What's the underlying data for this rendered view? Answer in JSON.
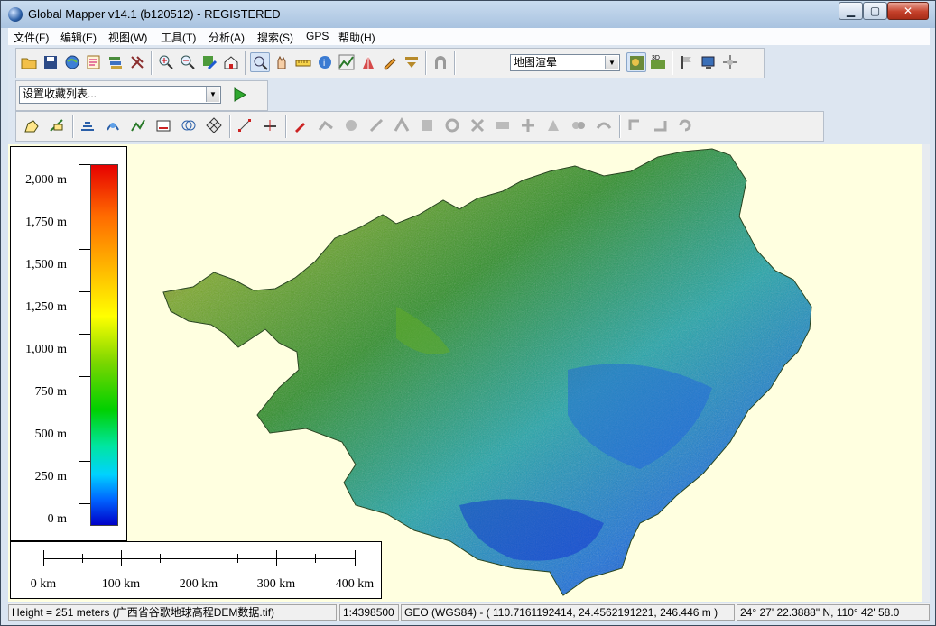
{
  "window": {
    "title": "Global Mapper v14.1 (b120512) - REGISTERED",
    "min_glyph": "▁",
    "max_glyph": "▢",
    "close_glyph": "✕"
  },
  "menu": [
    {
      "label": "文件(F)"
    },
    {
      "label": "编辑(E)"
    },
    {
      "label": "视图(W)"
    },
    {
      "label": "工具(T)"
    },
    {
      "label": "分析(A)"
    },
    {
      "label": "搜索(S)"
    },
    {
      "label": "GPS"
    },
    {
      "label": "帮助(H)"
    }
  ],
  "toolbar": {
    "render_mode": "地图渲晕",
    "favorites": "设置收藏列表..."
  },
  "legend": {
    "labels": [
      "2,000 m",
      "1,750 m",
      "1,500 m",
      "1,250 m",
      "1,000 m",
      "750 m",
      "500 m",
      "250 m",
      "0 m"
    ],
    "color_high": "#e60000",
    "color_low": "#0000c8"
  },
  "scalebar": {
    "labels": [
      "0 km",
      "100 km",
      "200 km",
      "300 km",
      "400 km"
    ]
  },
  "status": {
    "height": "Height = 251 meters (广西省谷歌地球高程DEM数据.tif)",
    "scale": "1:4398500",
    "coords": "GEO (WGS84) - ( 110.7161192414, 24.4562191221, 246.446 m )",
    "dms": "24° 27' 22.3888\" N, 110° 42' 58.0"
  }
}
